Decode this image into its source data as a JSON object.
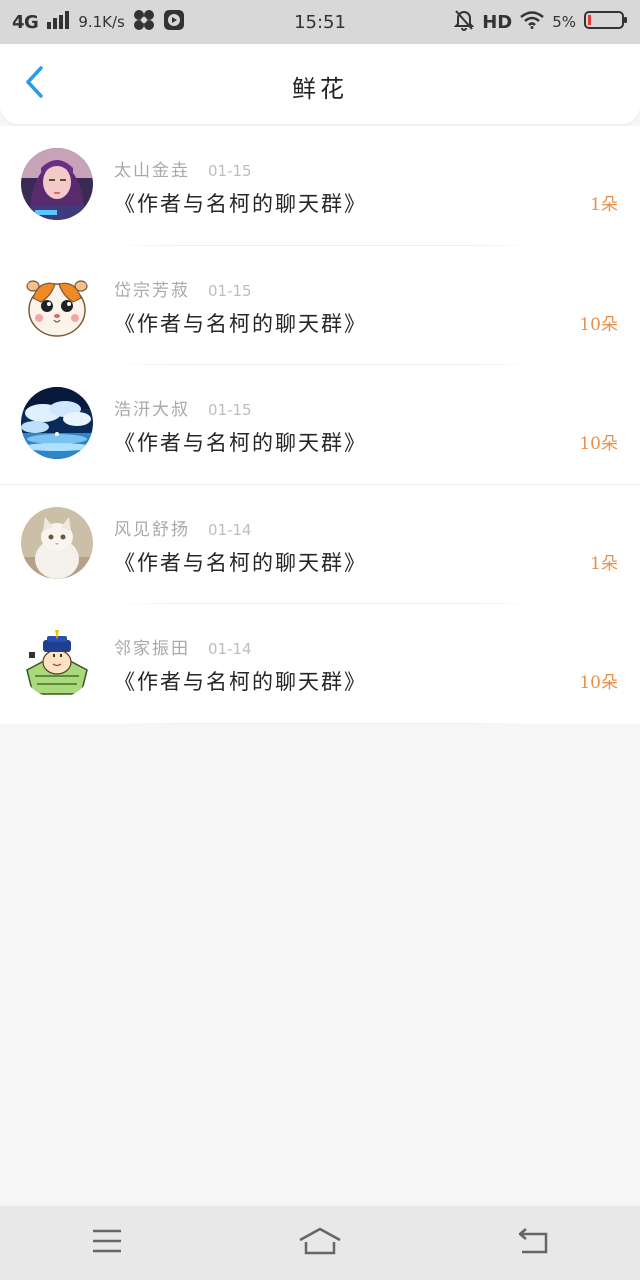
{
  "status_bar": {
    "network": "4G",
    "speed": "9.1K/s",
    "time": "15:51",
    "hd": "HD",
    "battery_percent": "5%",
    "icons": [
      "signal-icon",
      "pinwheel-icon",
      "video-play-icon",
      "bell-off-icon",
      "wifi-icon",
      "battery-icon"
    ]
  },
  "header": {
    "title": "鲜花",
    "back_icon": "chevron-left-icon",
    "accent_color": "#2b9be6"
  },
  "colors": {
    "count": "#e8904b",
    "name": "#a9a9a9",
    "date": "#bdbdbd",
    "group": "#262626"
  },
  "items": [
    {
      "user": "太山金垚",
      "date": "01-15",
      "group": "《作者与名柯的聊天群》",
      "count": "1朵",
      "avatar": "avatar-girl"
    },
    {
      "user": "岱宗芳菽",
      "date": "01-15",
      "group": "《作者与名柯的聊天群》",
      "count": "10朵",
      "avatar": "avatar-hamster"
    },
    {
      "user": "浩汧大叔",
      "date": "01-15",
      "group": "《作者与名柯的聊天群》",
      "count": "10朵",
      "avatar": "avatar-sky"
    },
    {
      "user": "风见舒扬",
      "date": "01-14",
      "group": "《作者与名柯的聊天群》",
      "count": "1朵",
      "avatar": "avatar-cat"
    },
    {
      "user": "邻家振田",
      "date": "01-14",
      "group": "《作者与名柯的聊天群》",
      "count": "10朵",
      "avatar": "avatar-cartoon"
    }
  ],
  "nav": {
    "icons": [
      "menu-icon",
      "home-icon",
      "back-arrow-icon"
    ]
  }
}
